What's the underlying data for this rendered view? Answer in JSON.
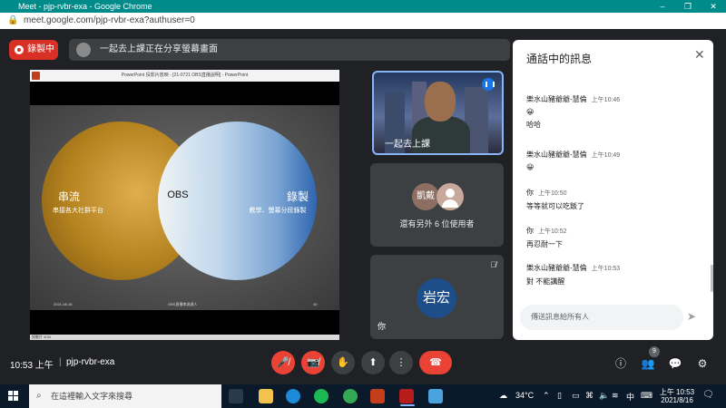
{
  "window": {
    "title": "Meet - pjp-rvbr-exa - Google Chrome",
    "url": "meet.google.com/pjp-rvbr-exa?authuser=0"
  },
  "recording_label": "錄製中",
  "presenting_text": "一起去上課正在分享螢幕畫面",
  "ppt": {
    "title_bar": "PowerPoint 投影片放映 - [21-0721 OBS直播說明] - PowerPoint",
    "status": "投影片 4/34",
    "footer": {
      "date": "2021-08-16",
      "center": "OBS直播串流達人",
      "page": "40"
    }
  },
  "slide": {
    "left_title": "串流",
    "left_sub": "串接各大社群平台",
    "center": "OBS",
    "right_title": "錄製",
    "right_sub": "教學、螢幕分段錄製"
  },
  "tiles": {
    "speaker_name": "一起去上課",
    "others_avatar": "凱戴",
    "others_text": "還有另外 6 位使用者",
    "self_avatar": "岩宏",
    "self_label": "你"
  },
  "chat": {
    "header": "通話中的訊息",
    "input_placeholder": "傳送訊息給所有人",
    "messages": [
      {
        "sender": "樂水山豬爺爺-慧倫",
        "time": "上午10:46",
        "lines": [
          "😀",
          "哈哈"
        ]
      },
      {
        "sender": "樂水山豬爺爺-慧倫",
        "time": "上午10:49",
        "lines": [
          "😀"
        ]
      },
      {
        "sender": "你",
        "time": "上午10:50",
        "lines": [
          "等等就可以吃飯了"
        ]
      },
      {
        "sender": "你",
        "time": "上午10:52",
        "lines": [
          "再忍耐一下"
        ]
      },
      {
        "sender": "樂水山豬爺爺-慧倫",
        "time": "上午10:53",
        "lines": [
          "對 不能講醒"
        ]
      }
    ]
  },
  "bottom": {
    "time": "10:53 上午",
    "separator": "|",
    "meeting_code": "pjp-rvbr-exa",
    "people_count": "9"
  },
  "taskbar": {
    "search_placeholder": "在這裡輸入文字來搜尋",
    "temperature": "34°C",
    "ime": "中",
    "time": "上午 10:53",
    "date": "2021/8/16"
  },
  "colors": {
    "accent": "#1a73e8",
    "danger": "#ea4335",
    "meet_bg": "#202124",
    "chrome_title": "#008b8b"
  }
}
